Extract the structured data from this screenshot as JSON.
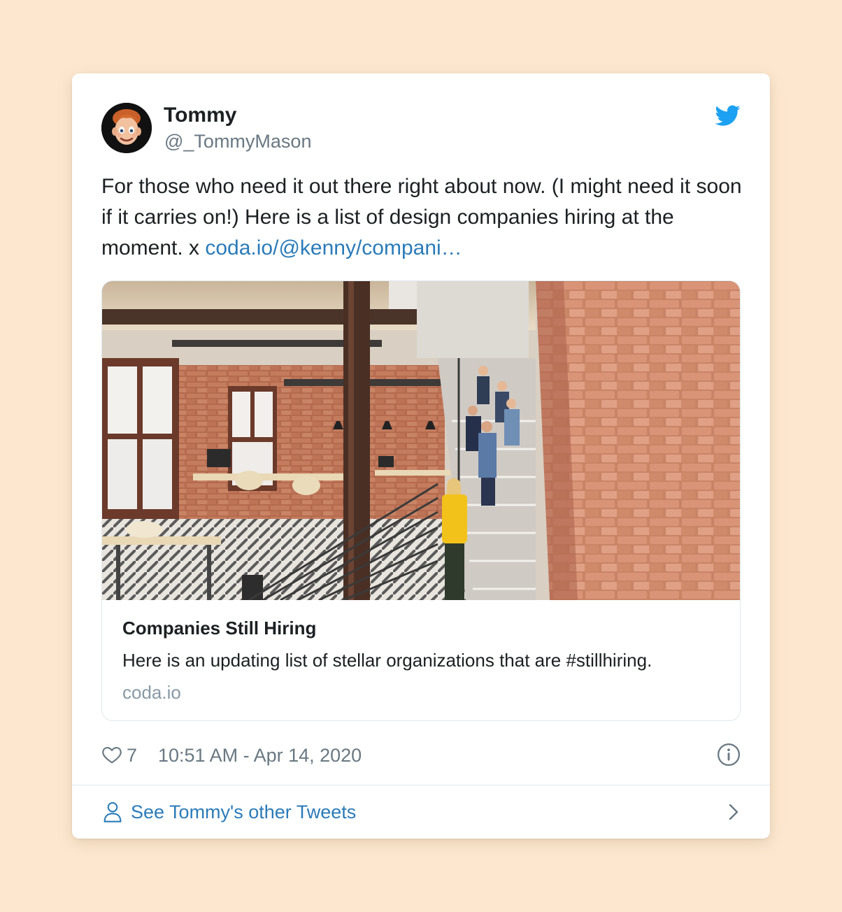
{
  "tweet": {
    "author_name": "Tommy",
    "author_handle": "@_TommyMason",
    "text_before_link": "For those who need it out there right about now. (I might need it soon if it carries on!) Here is a list of design companies hiring at the moment. x ",
    "link_text": "coda.io/@kenny/compani…",
    "like_count": "7",
    "timestamp": "10:51 AM - Apr 14, 2020"
  },
  "link_card": {
    "title": "Companies Still Hiring",
    "description": "Here is an updating list of stellar organizations that are #stillhiring.",
    "domain": "coda.io"
  },
  "footer": {
    "label": "See Tommy's other Tweets"
  },
  "icons": {
    "brand": "twitter-bird-icon",
    "like": "heart-icon",
    "info": "info-icon",
    "profile": "person-icon",
    "next": "chevron-right-icon"
  },
  "colors": {
    "page_background": "#fde8cf",
    "twitter_blue": "#1da1f2",
    "link": "#2b7bb9",
    "secondary_text": "#697882",
    "border": "#e1e8ed"
  }
}
